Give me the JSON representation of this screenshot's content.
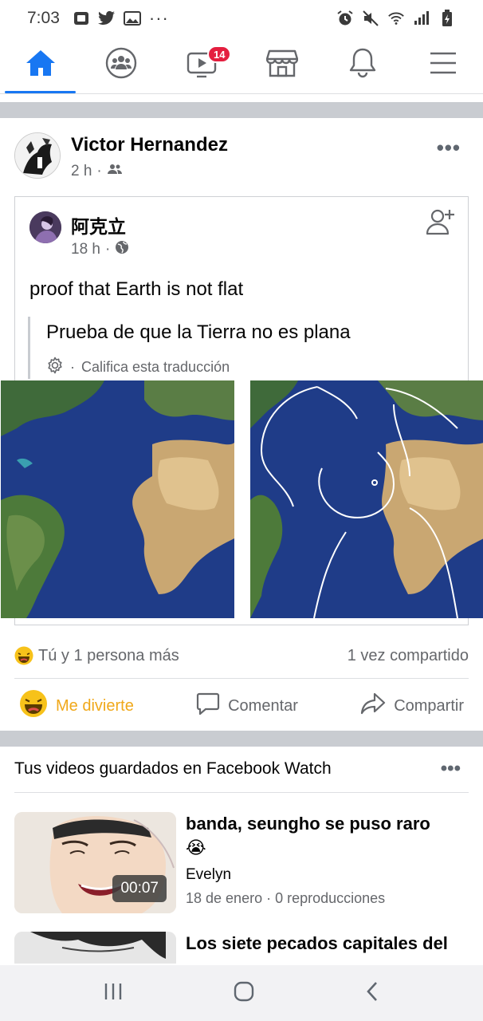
{
  "status_bar": {
    "time": "7:03",
    "dots": "···"
  },
  "tabs": [
    {
      "name": "home",
      "active": true
    },
    {
      "name": "groups"
    },
    {
      "name": "watch",
      "badge": "14"
    },
    {
      "name": "marketplace"
    },
    {
      "name": "notifications"
    },
    {
      "name": "menu"
    }
  ],
  "post": {
    "author": "Victor Hernandez",
    "time": "2 h",
    "more": "•••",
    "shared": {
      "author": "阿克立",
      "time": "18 h",
      "text": "proof that Earth is not flat",
      "translation": "Prueba de que la Tierra no es plana",
      "rate_translation": "Califica esta traducción"
    },
    "reactions_text": "Tú y 1 persona más",
    "shares_text": "1 vez compartido",
    "actions": {
      "laugh": "Me divierte",
      "comment": "Comentar",
      "share": "Compartir"
    }
  },
  "saved_videos": {
    "title": "Tus videos guardados en Facebook Watch",
    "more": "•••",
    "items": [
      {
        "title": "banda, seungho se puso raro",
        "emoji": "😭",
        "author": "Evelyn",
        "meta": "18 de enero · 0 reproducciones",
        "duration": "00:07"
      },
      {
        "title": "Los siete pecados capitales del"
      }
    ]
  },
  "colors": {
    "accent": "#1877f2",
    "badge": "#e41e3f",
    "laugh": "#f0a81a",
    "secondary_text": "#65676b"
  }
}
